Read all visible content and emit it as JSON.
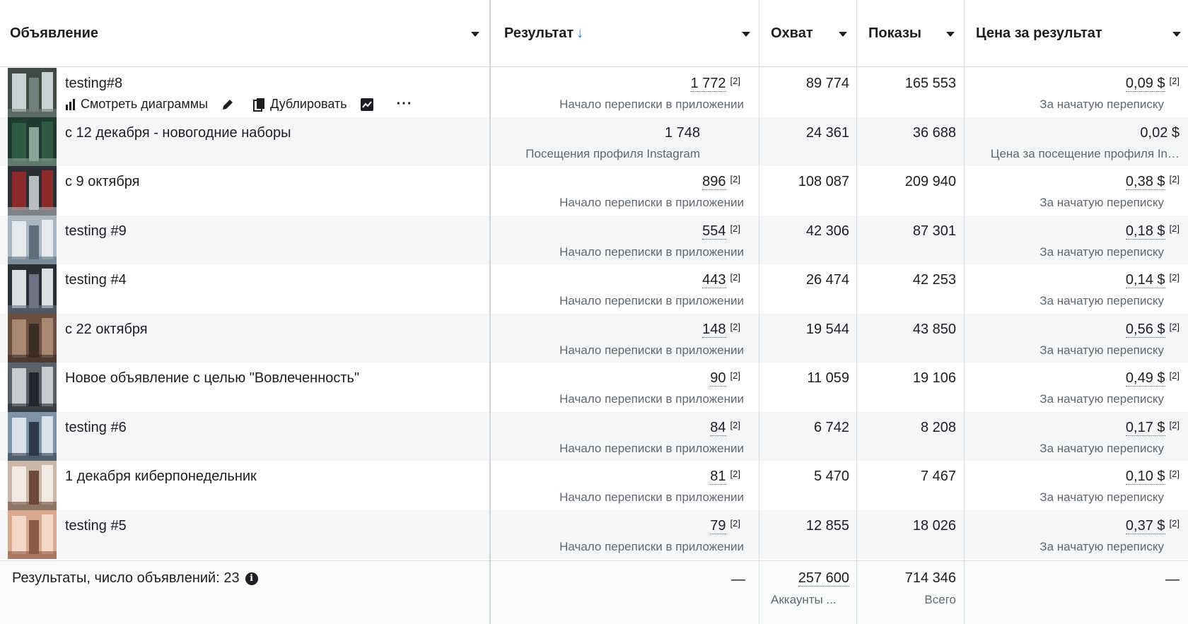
{
  "columns": {
    "ad": "Объявление",
    "result": "Результат",
    "result_sort": "↓",
    "reach": "Охват",
    "impressions": "Показы",
    "cpr": "Цена за результат"
  },
  "action_labels": {
    "view_charts": "Смотреть диаграммы",
    "duplicate": "Дублировать",
    "more": "···"
  },
  "footnote_marker": "[2]",
  "rows": [
    {
      "name": "testing#8",
      "result": "1 772",
      "result_sub": "Начало переписки в приложении",
      "reach": "89 774",
      "impressions": "165 553",
      "cpr": "0,09 $",
      "cpr_sub": "За начатую переписку",
      "thumb_colors": [
        "#3f4a44",
        "#c9d3d3",
        "#6f7f79"
      ]
    },
    {
      "name": "с 12 декабря - новогодние наборы",
      "result": "1 748",
      "result_sub": "Посещения профиля Instagram",
      "reach": "24 361",
      "impressions": "36 688",
      "cpr": "0,02 $",
      "cpr_sub": "Цена за посещение профиля In…",
      "thumb_colors": [
        "#1f3a2e",
        "#2f5a44",
        "#8aa596"
      ]
    },
    {
      "name": "с 9 октября",
      "result": "896",
      "result_sub": "Начало переписки в приложении",
      "reach": "108 087",
      "impressions": "209 940",
      "cpr": "0,38 $",
      "cpr_sub": "За начатую переписку",
      "thumb_colors": [
        "#2b2f33",
        "#8b2a2a",
        "#b8bcc0"
      ]
    },
    {
      "name": "testing #9",
      "result": "554",
      "result_sub": "Начало переписки в приложении",
      "reach": "42 306",
      "impressions": "87 301",
      "cpr": "0,18 $",
      "cpr_sub": "За начатую переписку",
      "thumb_colors": [
        "#a9b7c2",
        "#e4eaee",
        "#5d6e7a"
      ]
    },
    {
      "name": "testing #4",
      "result": "443",
      "result_sub": "Начало переписки в приложении",
      "reach": "26 474",
      "impressions": "42 253",
      "cpr": "0,14 $",
      "cpr_sub": "За начатую переписку",
      "thumb_colors": [
        "#2a2f36",
        "#dcdfe2",
        "#6b7480"
      ]
    },
    {
      "name": "с 22 октября",
      "result": "148",
      "result_sub": "Начало переписки в приложении",
      "reach": "19 544",
      "impressions": "43 850",
      "cpr": "0,56 $",
      "cpr_sub": "За начатую переписку",
      "thumb_colors": [
        "#6b4f41",
        "#a88873",
        "#3b2c24"
      ]
    },
    {
      "name": "Новое объявление с целью \"Вовлеченность\"",
      "result": "90",
      "result_sub": "Начало переписки в приложении",
      "reach": "11 059",
      "impressions": "19 106",
      "cpr": "0,49 $",
      "cpr_sub": "За начатую переписку",
      "thumb_colors": [
        "#5a6169",
        "#c7ccd1",
        "#23272b"
      ]
    },
    {
      "name": "testing #6",
      "result": "84",
      "result_sub": "Начало переписки в приложении",
      "reach": "6 742",
      "impressions": "8 208",
      "cpr": "0,17 $",
      "cpr_sub": "За начатую переписку",
      "thumb_colors": [
        "#7f93a7",
        "#d9e2ea",
        "#2d3a47"
      ]
    },
    {
      "name": "1 декабря киберпонедельник",
      "result": "81",
      "result_sub": "Начало переписки в приложении",
      "reach": "5 470",
      "impressions": "7 467",
      "cpr": "0,10 $",
      "cpr_sub": "За начатую переписку",
      "thumb_colors": [
        "#c9b8a8",
        "#f1e9e2",
        "#6a4a3a"
      ]
    },
    {
      "name": "testing #5",
      "result": "79",
      "result_sub": "Начало переписки в приложении",
      "reach": "12 855",
      "impressions": "18 026",
      "cpr": "0,37 $",
      "cpr_sub": "За начатую переписку",
      "thumb_colors": [
        "#d9a98f",
        "#f3d7c7",
        "#8a5a44"
      ]
    }
  ],
  "footer": {
    "label": "Результаты, число объявлений: 23",
    "result": "—",
    "reach": "257 600",
    "reach_sub": "Аккаунты ...",
    "impressions": "714 346",
    "impressions_sub": "Всего",
    "cpr": "—"
  },
  "colors": {
    "sort_accent": "#1877f2",
    "alt_row": "#f5f6f7",
    "muted_text": "#606770"
  }
}
